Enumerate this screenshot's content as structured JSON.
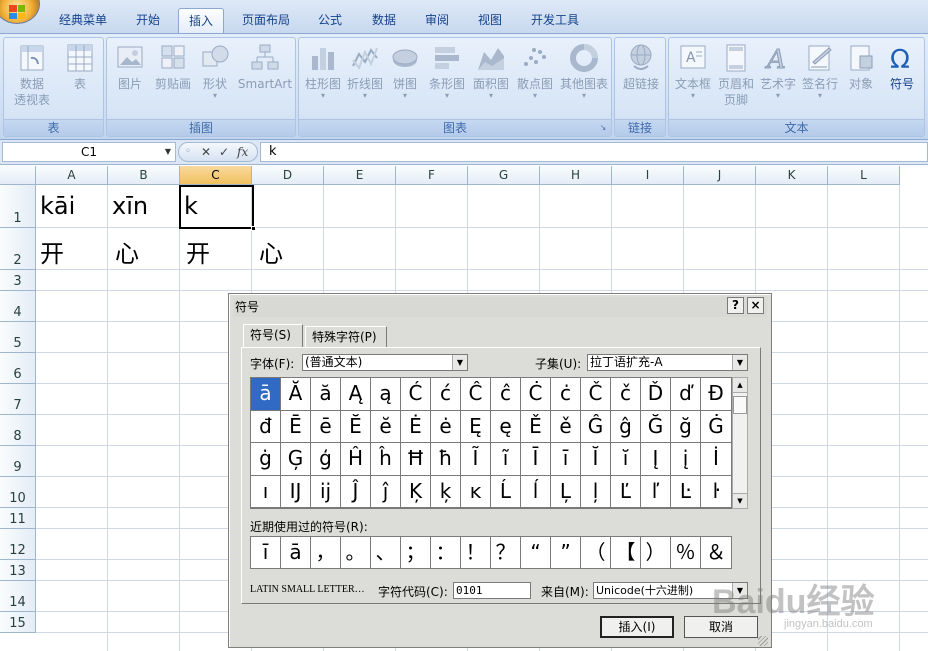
{
  "ribbon": {
    "tabs": [
      "经典菜单",
      "开始",
      "插入",
      "页面布局",
      "公式",
      "数据",
      "审阅",
      "视图",
      "开发工具"
    ],
    "active_tab": "插入",
    "groups": {
      "table": {
        "label": "表",
        "pivot": "数据\n透视表",
        "table": "表"
      },
      "illustrations": {
        "label": "插图",
        "picture": "图片",
        "clipart": "剪贴画",
        "shapes": "形状",
        "smartart": "SmartArt"
      },
      "charts": {
        "label": "图表",
        "column": "柱形图",
        "line": "折线图",
        "pie": "饼图",
        "bar": "条形图",
        "area": "面积图",
        "scatter": "散点图",
        "other": "其他图表"
      },
      "links": {
        "label": "链接",
        "hyperlink": "超链接"
      },
      "text": {
        "label": "文本",
        "textbox": "文本框",
        "header_footer": "页眉和\n页脚",
        "wordart": "艺术字",
        "signature": "签名行",
        "object": "对象",
        "symbol": "符号"
      }
    }
  },
  "formula_bar": {
    "name_box": "C1",
    "fx": "fx",
    "content": "k"
  },
  "sheet": {
    "columns": [
      "A",
      "B",
      "C",
      "D",
      "E",
      "F",
      "G",
      "H",
      "I",
      "J",
      "K",
      "L"
    ],
    "selected_column": "C",
    "rows": [
      "1",
      "2",
      "3",
      "4",
      "5",
      "6",
      "7",
      "8",
      "9",
      "10",
      "11",
      "12",
      "13",
      "14",
      "15"
    ],
    "cells": {
      "A1": "kāi",
      "B1": "xīn",
      "C1": "k",
      "A2": "开",
      "B2": "心",
      "C2": "开",
      "D2": "心"
    }
  },
  "dialog": {
    "title": "符号",
    "help": "?",
    "close": "×",
    "tabs": [
      "符号(S)",
      "特殊字符(P)"
    ],
    "font_label": "字体(F):",
    "font_value": "(普通文本)",
    "subset_label": "子集(U):",
    "subset_value": "拉丁语扩充-A",
    "symbols": [
      "ā",
      "Ă",
      "ă",
      "Ą",
      "ą",
      "Ć",
      "ć",
      "Ĉ",
      "ĉ",
      "Ċ",
      "ċ",
      "Č",
      "č",
      "Ď",
      "ď",
      "Đ",
      "đ",
      "Ē",
      "ē",
      "Ĕ",
      "ĕ",
      "Ė",
      "ė",
      "Ę",
      "ę",
      "Ě",
      "ě",
      "Ĝ",
      "ĝ",
      "Ğ",
      "ğ",
      "Ġ",
      "ġ",
      "Ģ",
      "ģ",
      "Ĥ",
      "ĥ",
      "Ħ",
      "ħ",
      "Ĩ",
      "ĩ",
      "Ī",
      "ī",
      "Ĭ",
      "ĭ",
      "Į",
      "į",
      "İ",
      "ı",
      "Ĳ",
      "ĳ",
      "Ĵ",
      "ĵ",
      "Ķ",
      "ķ",
      "ĸ",
      "Ĺ",
      "ĺ",
      "Ļ",
      "ļ",
      "Ľ",
      "ľ",
      "Ŀ",
      "ŀ"
    ],
    "selected_symbol": "ā",
    "recent_label": "近期使用过的符号(R):",
    "recent": [
      "ī",
      "ā",
      "，",
      "。",
      "、",
      "；",
      "：",
      "！",
      "？",
      "“",
      "”",
      "（",
      "【",
      "）",
      "％",
      "＆"
    ],
    "char_name": "LATIN SMALL LETTER…",
    "code_label": "字符代码(C):",
    "code_value": "0101",
    "from_label": "来自(M):",
    "from_value": "Unicode(十六进制)",
    "insert_btn": "插入(I)",
    "cancel_btn": "取消"
  },
  "watermark": {
    "text": "Baidu经验",
    "sub": "jingyan.baidu.com"
  },
  "colors": {
    "selection": "#316ac5",
    "selected_header": "#f1c15f",
    "ribbon": "#cfdff4"
  }
}
